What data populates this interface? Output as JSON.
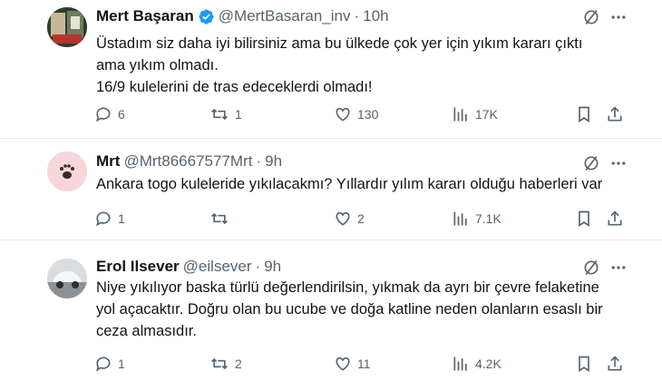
{
  "tweets": [
    {
      "name": "Mert Başaran",
      "handle": "@MertBasaran_inv",
      "time": "10h",
      "verified": true,
      "lines": [
        "Üstadım siz daha iyi bilirsiniz ama bu ülkede çok yer için yıkım kararı çıktı",
        "ama yıkım olmadı.",
        "16/9 kulelerini de tras edeceklerdi olmadı!"
      ],
      "replies": "6",
      "reposts": "1",
      "likes": "130",
      "views": "17K"
    },
    {
      "name": "Mrt",
      "handle": "@Mrt86667577Mrt",
      "time": "9h",
      "verified": false,
      "lines": [
        "Ankara togo kuleleride yıkılacakmı? Yıllardır yılım kararı olduğu haberleri var"
      ],
      "replies": "1",
      "reposts": "",
      "likes": "2",
      "views": "7.1K"
    },
    {
      "name": "Erol Ilsever",
      "handle": "@eilsever",
      "time": "9h",
      "verified": false,
      "lines": [
        "Niye yıkılıyor baska türlü değerlendirilsin, yıkmak da ayrı bir çevre felaketine",
        "yol açacaktır. Doğru olan bu ucube ve doğa katline neden olanların esaslı bir",
        "ceza almasıdır."
      ],
      "replies": "1",
      "reposts": "2",
      "likes": "11",
      "views": "4.2K"
    }
  ],
  "colors": {
    "text": "#0f1419",
    "secondary": "#536471",
    "verified": "#1d9bf0",
    "divider": "#e6e9ea"
  },
  "icons": {
    "reply": "reply-icon",
    "repost": "repost-icon",
    "like": "heart-icon",
    "views": "views-icon",
    "bookmark": "bookmark-icon",
    "share": "share-icon",
    "grok": "grok-icon",
    "more": "more-icon"
  }
}
